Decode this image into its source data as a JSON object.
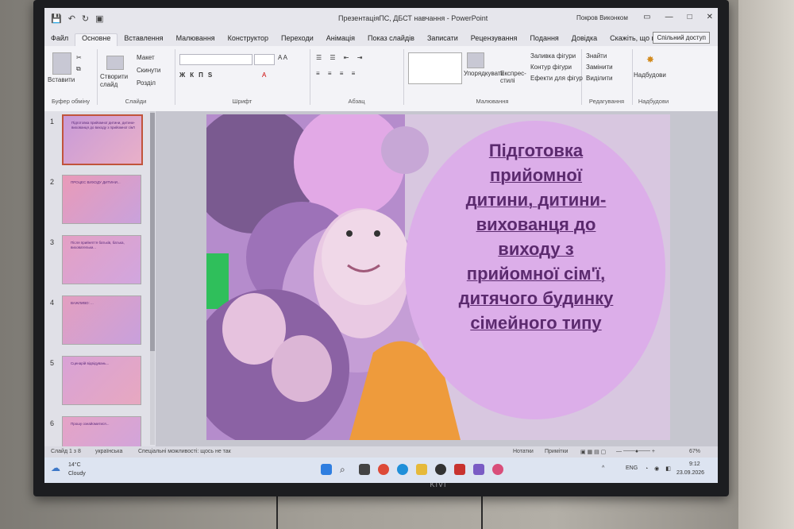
{
  "window": {
    "title": "ПрезентаціяПС, ДБСТ навчання - PowerPoint",
    "user": "Покров Виконком",
    "quick_access": [
      "💾",
      "↶",
      "↻",
      "▣"
    ]
  },
  "tabs": [
    {
      "label": "Файл",
      "active": false
    },
    {
      "label": "Основне",
      "active": true
    },
    {
      "label": "Вставлення",
      "active": false
    },
    {
      "label": "Малювання",
      "active": false
    },
    {
      "label": "Конструктор",
      "active": false
    },
    {
      "label": "Переходи",
      "active": false
    },
    {
      "label": "Анімація",
      "active": false
    },
    {
      "label": "Показ слайдів",
      "active": false
    },
    {
      "label": "Записати",
      "active": false
    },
    {
      "label": "Рецензування",
      "active": false
    },
    {
      "label": "Подання",
      "active": false
    },
    {
      "label": "Довідка",
      "active": false
    }
  ],
  "tell_me": "Скажіть, що потрібно зробити",
  "share_label": "Спільний доступ",
  "ribbon": {
    "clipboard": {
      "paste": "Вставити",
      "label": "Буфер обміну"
    },
    "slides": {
      "new_slide": "Створити слайд",
      "layout": "Макет",
      "reset": "Скинути",
      "section": "Розділ",
      "label": "Слайди"
    },
    "font": {
      "label": "Шрифт"
    },
    "paragraph": {
      "label": "Абзац"
    },
    "drawing": {
      "arrange": "Упорядкувати",
      "quick_styles": "Експрес-стилі",
      "fill": "Заливка фігури",
      "outline": "Контур фігури",
      "effects": "Ефекти для фігур",
      "label": "Малювання"
    },
    "editing": {
      "find": "Знайти",
      "replace": "Замінити",
      "select": "Виділити",
      "label": "Редагування"
    },
    "addins": {
      "button": "Надбудови",
      "label": "Надбудови"
    }
  },
  "thumbnails": [
    {
      "num": "1",
      "selected": true,
      "text": "Підготовка прийомної дитини, дитини-вихованця до виходу з прийомної сім'ї"
    },
    {
      "num": "2",
      "selected": false,
      "text": "ПРОЦЕС ВИХОДУ ДИТИНИ..."
    },
    {
      "num": "3",
      "selected": false,
      "text": "Після прийняття батьків, батька, виховательки..."
    },
    {
      "num": "4",
      "selected": false,
      "text": "ВАЖЛИВО: ..."
    },
    {
      "num": "5",
      "selected": false,
      "text": "Сценарій відвідувань..."
    },
    {
      "num": "6",
      "selected": false,
      "text": "Прошу ознайомитися..."
    }
  ],
  "slide": {
    "title_lines": [
      "Підготовка",
      "прийомної",
      "дитини, дитини-",
      "вихованця до",
      "виходу з",
      "прийомної сім'ї,",
      "дитячого будинку",
      "сімейного типу"
    ]
  },
  "statusbar": {
    "slide_info": "Слайд 1 з 8",
    "language": "українська",
    "accessibility": "Спеціальні можливості: щось не так",
    "notes": "Нотатки",
    "comments": "Примітки",
    "zoom": "67%"
  },
  "taskbar": {
    "weather_temp": "14°C",
    "weather_desc": "Cloudy",
    "lang": "ENG",
    "time": "9:12",
    "date": "23.09.2026"
  },
  "monitor_brand": "KIVI",
  "colors": {
    "slide_title": "#5b2a6e",
    "bubble": "#dcaee9",
    "selected_thumb_border": "#c1543b"
  }
}
